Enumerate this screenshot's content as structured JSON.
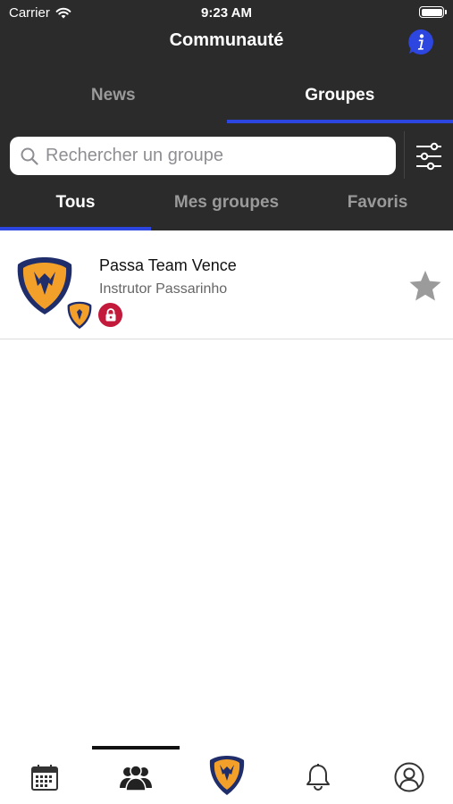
{
  "status_bar": {
    "carrier": "Carrier",
    "time": "9:23 AM"
  },
  "header": {
    "title": "Communauté",
    "info_icon": "info-icon"
  },
  "top_tabs": [
    {
      "label": "News",
      "active": false
    },
    {
      "label": "Groupes",
      "active": true
    }
  ],
  "search": {
    "placeholder": "Rechercher un groupe",
    "icon": "search-icon",
    "filter_icon": "filter-sliders-icon"
  },
  "sub_tabs": [
    {
      "label": "Tous",
      "active": true
    },
    {
      "label": "Mes groupes",
      "active": false
    },
    {
      "label": "Favoris",
      "active": false
    }
  ],
  "groups": [
    {
      "name": "Passa Team Vence",
      "owner": "Instrutor Passarinho",
      "private": true,
      "favorite": false
    }
  ],
  "bottom_nav": {
    "items": [
      {
        "icon": "calendar-icon",
        "active": false
      },
      {
        "icon": "community-icon",
        "active": true
      },
      {
        "icon": "club-logo-icon",
        "active": false
      },
      {
        "icon": "bell-icon",
        "active": false
      },
      {
        "icon": "profile-icon",
        "active": false
      }
    ]
  },
  "colors": {
    "header_bg": "#2b2b2b",
    "accent": "#2d46e0",
    "lock_badge": "#c3193a",
    "logo_navy": "#1f2d6b",
    "logo_orange": "#f2a02a"
  }
}
